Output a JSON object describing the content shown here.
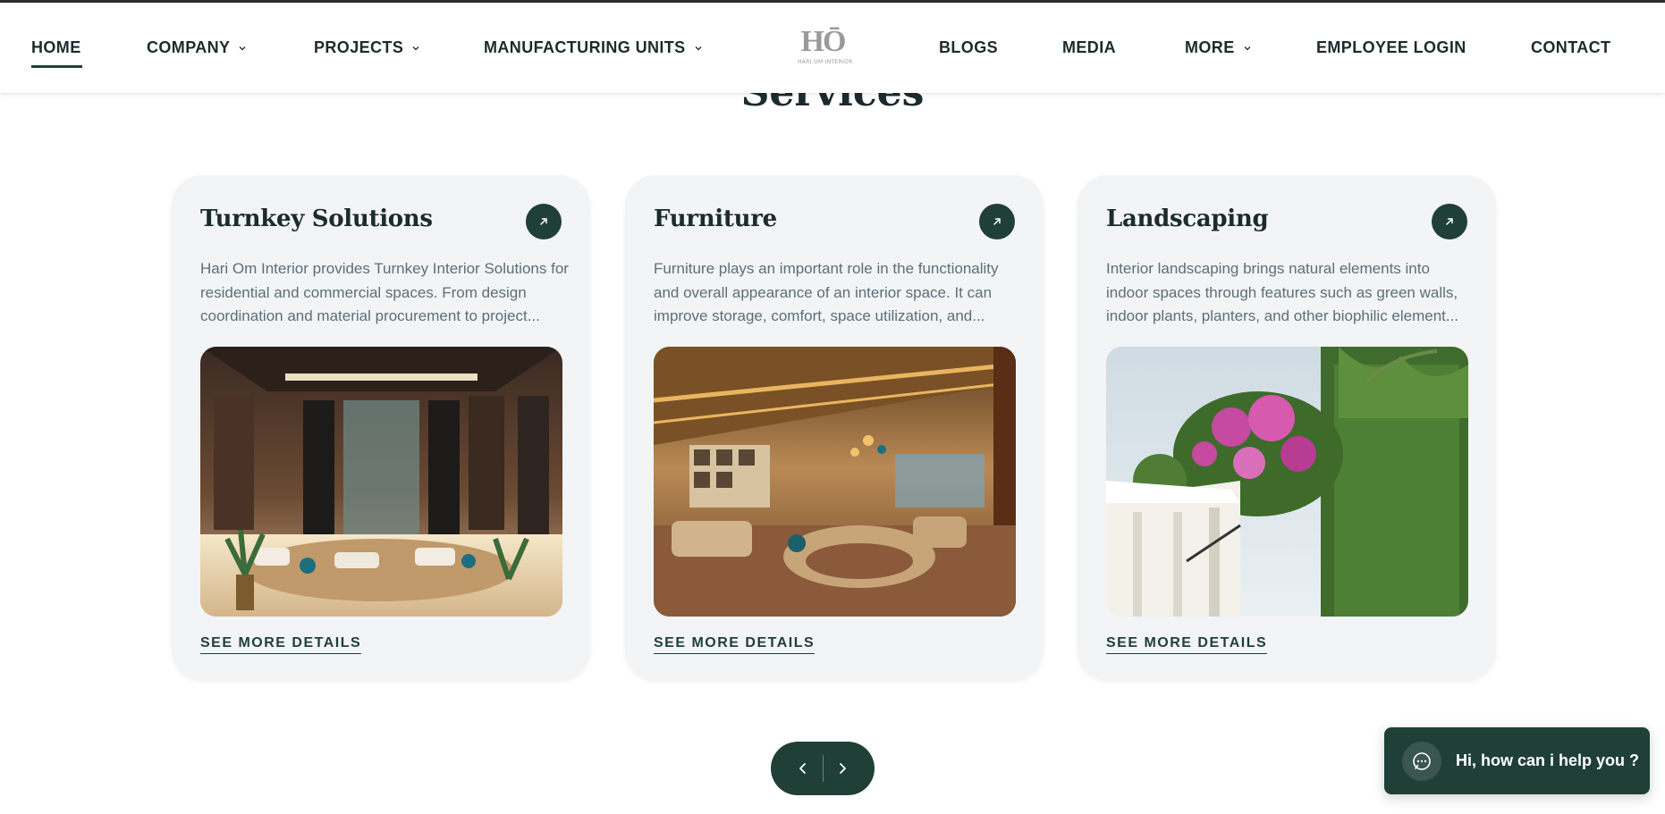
{
  "colors": {
    "accent": "#1f3f37",
    "card_bg": "#f2f4f5",
    "text_dark": "#1c2b2d",
    "text_muted": "#5e6e78"
  },
  "header": {
    "logo": {
      "mark": "HŌ",
      "subtitle": "HARI OM INTERIOR"
    },
    "nav": {
      "home": "HOME",
      "company": "COMPANY",
      "projects": "PROJECTS",
      "manufacturing_units": "MANUFACTURING UNITS",
      "blogs": "BLOGS",
      "media": "MEDIA",
      "more": "MORE",
      "employee_login": "EMPLOYEE LOGIN",
      "contact": "CONTACT"
    },
    "active_nav": "home"
  },
  "section": {
    "heading": "Services"
  },
  "cards": [
    {
      "title": "Turnkey Solutions",
      "description": "Hari Om Interior provides Turnkey Interior Solutions for residential and commercial spaces. From design coordination and material procurement to project...",
      "link_label": "SEE MORE DETAILS",
      "arrow_icon": "arrow-up-right-icon"
    },
    {
      "title": "Furniture",
      "description": "Furniture plays an important role in the functionality and overall appearance of an interior space. It can improve storage, comfort, space utilization, and...",
      "link_label": "SEE MORE DETAILS",
      "arrow_icon": "arrow-up-right-icon"
    },
    {
      "title": "Landscaping",
      "description": "Interior landscaping brings natural elements into indoor spaces through features such as green walls, indoor plants, planters, and other biophilic element...",
      "link_label": "SEE MORE DETAILS",
      "arrow_icon": "arrow-up-right-icon"
    }
  ],
  "slider": {
    "prev_icon": "chevron-left-icon",
    "next_icon": "chevron-right-icon"
  },
  "chat": {
    "label": "Hi, how can i help you ?",
    "icon": "chat-bubble-icon"
  }
}
